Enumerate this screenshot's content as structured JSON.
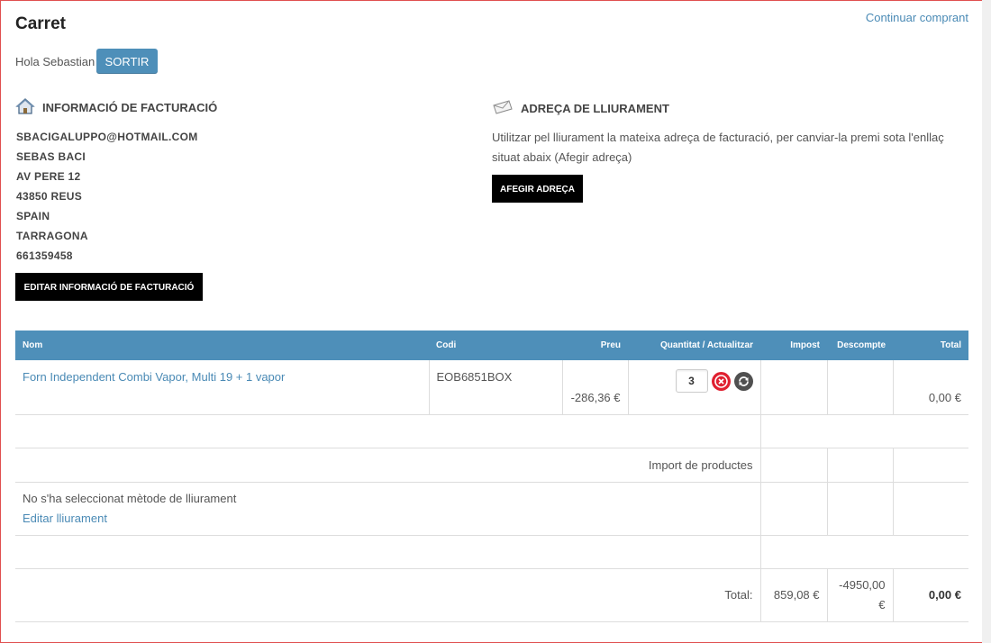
{
  "page": {
    "title": "Carret",
    "continue_link": "Continuar comprant"
  },
  "user": {
    "greeting": "Hola Sebastian",
    "logout_label": "SORTIR"
  },
  "billing": {
    "heading": "INFORMACIÓ DE FACTURACIÓ",
    "lines": [
      "SBACIGALUPPO@HOTMAIL.COM",
      "SEBAS BACI",
      "AV PERE 12",
      "43850 REUS",
      "SPAIN",
      "TARRAGONA",
      "661359458"
    ],
    "edit_button": "EDITAR INFORMACIÓ DE FACTURACIÓ",
    "icon": "house-icon"
  },
  "delivery": {
    "heading": "ADREÇA DE LLIURAMENT",
    "text": "Utilitzar pel lliurament la mateixa adreça de facturació, per canviar-la premi sota l'enllaç situat abaix (Afegir adreça)",
    "add_button": "AFEGIR ADREÇA",
    "icon": "envelope-icon"
  },
  "table": {
    "headers": {
      "name": "Nom",
      "code": "Codi",
      "price": "Preu",
      "qty": "Quantitat / Actualitzar",
      "tax": "Impost",
      "discount": "Descompte",
      "total": "Total"
    },
    "item": {
      "name": "Forn Independent Combi Vapor, Multi 19 + 1 vapor",
      "code": "EOB6851BOX",
      "price": "-286,36 €",
      "qty": "3",
      "total": "0,00 €"
    },
    "products_label": "Import de productes",
    "shipping": {
      "message": "No s'ha seleccionat mètode de lliurament",
      "edit_link": "Editar lliurament"
    },
    "totals": {
      "label": "Total:",
      "tax": "859,08 €",
      "discount": "-4950,00 €",
      "total": "0,00 €"
    }
  },
  "colors": {
    "header_blue": "#4e8fb9",
    "link_blue": "#4a8ab5",
    "delete_red": "#e02030"
  }
}
